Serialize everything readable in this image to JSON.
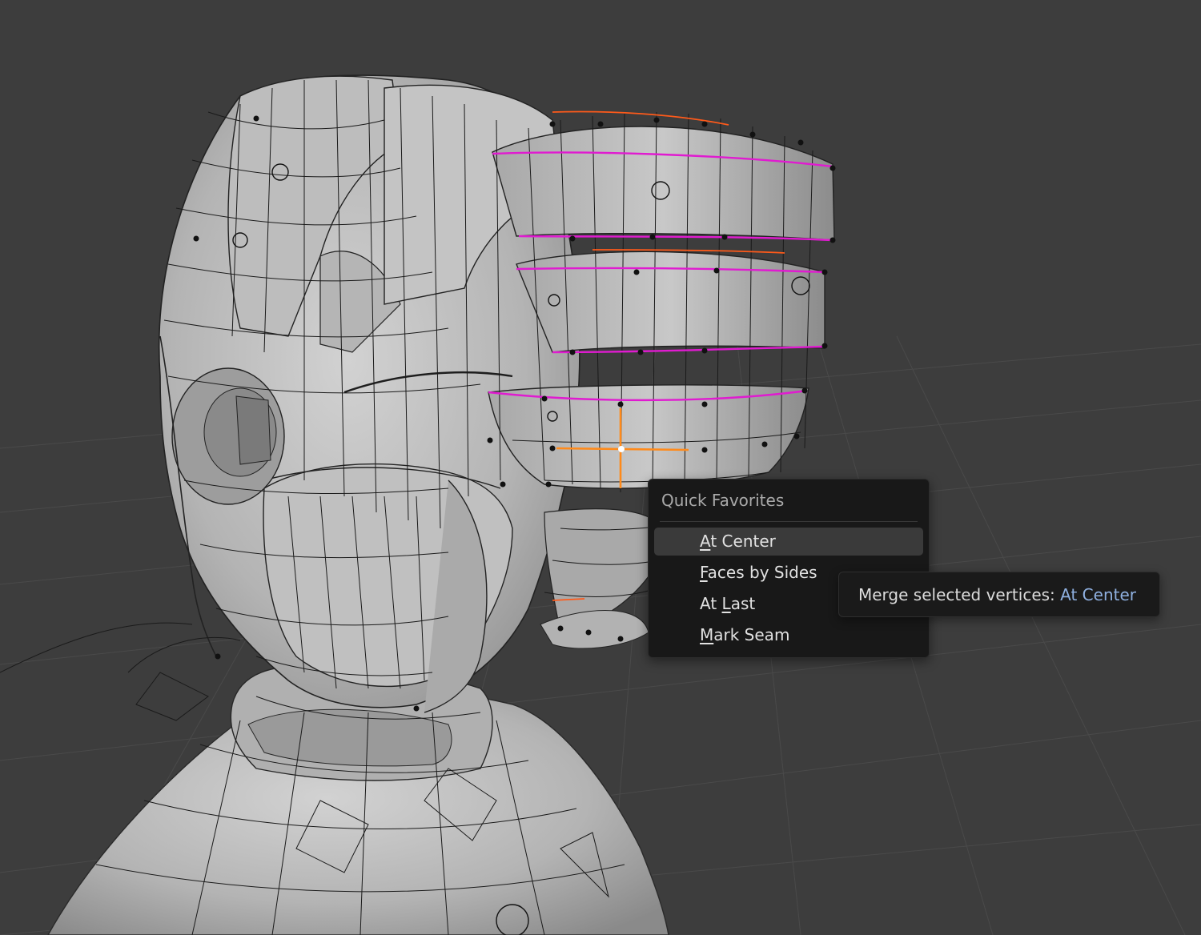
{
  "menu": {
    "title": "Quick Favorites",
    "items": [
      {
        "key": "A",
        "rest": "t Center",
        "active": true
      },
      {
        "key": "F",
        "rest": "aces by Sides",
        "active": false
      },
      {
        "pre": "At ",
        "key": "L",
        "rest": "ast",
        "active": false
      },
      {
        "key": "M",
        "rest": "ark Seam",
        "active": false
      }
    ]
  },
  "tooltip": {
    "text": "Merge selected vertices: ",
    "value": "At Center"
  },
  "colors": {
    "background": "#3d3d3d",
    "mesh": "#b8b8b8",
    "seam": "#e01bd0",
    "selected_edge": "#ff8a1a",
    "tooltip_value": "#8fb0e0"
  }
}
